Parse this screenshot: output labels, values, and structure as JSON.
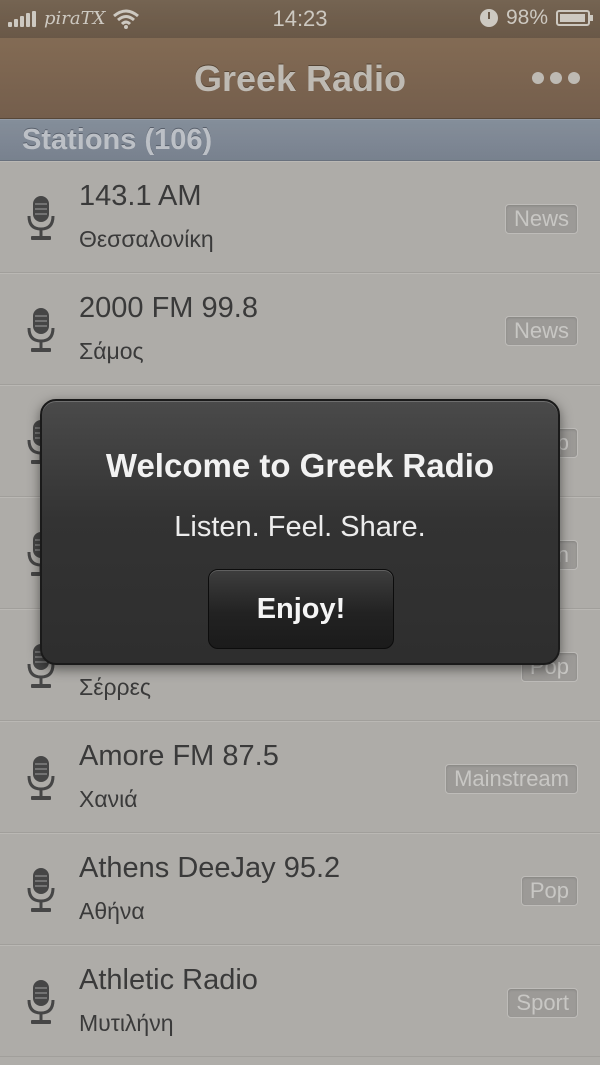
{
  "status_bar": {
    "carrier": "piraTX",
    "time": "14:23",
    "battery": "98%",
    "battery_level": 0.98
  },
  "nav": {
    "title": "Greek Radio",
    "more_icon": "ellipsis-icon"
  },
  "section": {
    "title": "Stations (106)"
  },
  "stations": [
    {
      "name": "143.1 AM",
      "city": "Θεσσαλονίκη",
      "genre": "News"
    },
    {
      "name": "2000 FM 99.8",
      "city": "Σάμος",
      "genre": "News"
    },
    {
      "name": "",
      "city": "",
      "genre": "p"
    },
    {
      "name": "",
      "city": "",
      "genre": "n"
    },
    {
      "name": "",
      "city": "Σέρρες",
      "genre": "Pop"
    },
    {
      "name": "Amore FM 87.5",
      "city": "Χανιά",
      "genre": "Mainstream"
    },
    {
      "name": "Athens DeeJay 95.2",
      "city": "Αθήνα",
      "genre": "Pop"
    },
    {
      "name": "Athletic Radio",
      "city": "Μυτιλήνη",
      "genre": "Sport"
    }
  ],
  "alert": {
    "title": "Welcome to Greek Radio",
    "message": "Listen. Feel. Share.",
    "button": "Enjoy!"
  },
  "colors": {
    "navbar": "#7b6451",
    "section": "#8c96a3",
    "row": "#b8b6b2",
    "alert": "#333333"
  }
}
